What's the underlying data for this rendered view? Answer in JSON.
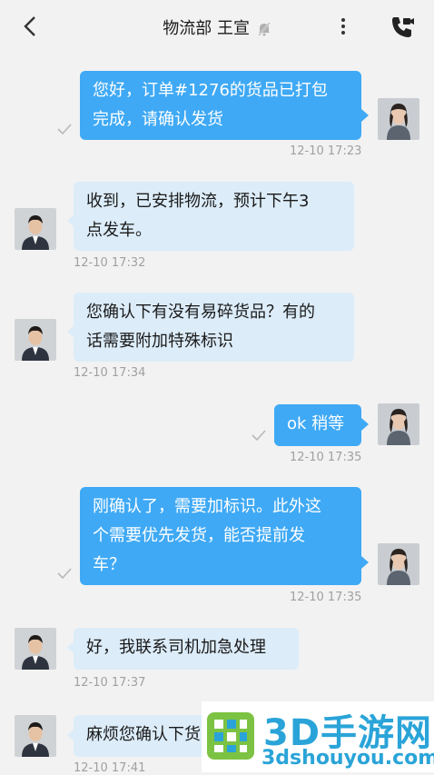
{
  "header": {
    "title": "物流部 王宣",
    "icons": {
      "back": "back-arrow-icon",
      "mute": "muted-bell-icon",
      "more": "more-vertical-icon",
      "call": "video-call-icon"
    }
  },
  "messages": [
    {
      "sender": "me",
      "lines": [
        "您好，订单#1276的货品已打包",
        "完成，请确认发货"
      ],
      "time": "12-10 17:23"
    },
    {
      "sender": "other",
      "lines": [
        "收到，已安排物流，预计下午3",
        "点发车。"
      ],
      "time": "12-10 17:32"
    },
    {
      "sender": "other",
      "lines": [
        "您确认下有没有易碎货品？有的",
        "话需要附加特殊标识"
      ],
      "time": "12-10 17:34"
    },
    {
      "sender": "me",
      "lines": [
        "ok 稍等"
      ],
      "time": "12-10 17:35"
    },
    {
      "sender": "me",
      "lines": [
        "刚确认了，需要加标识。此外这",
        "个需要优先发货，能否提前发",
        "车？"
      ],
      "time": "12-10 17:35"
    },
    {
      "sender": "other",
      "lines": [
        "好，我联系司机加急处理"
      ],
      "time": "12-10 17:37"
    },
    {
      "sender": "other",
      "lines": [
        "麻烦您确认下货"
      ],
      "time": "12-10 17:41"
    }
  ],
  "watermark": {
    "text": "3D手游网",
    "url": "3dshouyou.com"
  },
  "colors": {
    "my_bubble": "#3fa9f5",
    "other_bubble": "#dcecf9",
    "background": "#f2f2f2",
    "time_text": "#a0a0a0"
  }
}
